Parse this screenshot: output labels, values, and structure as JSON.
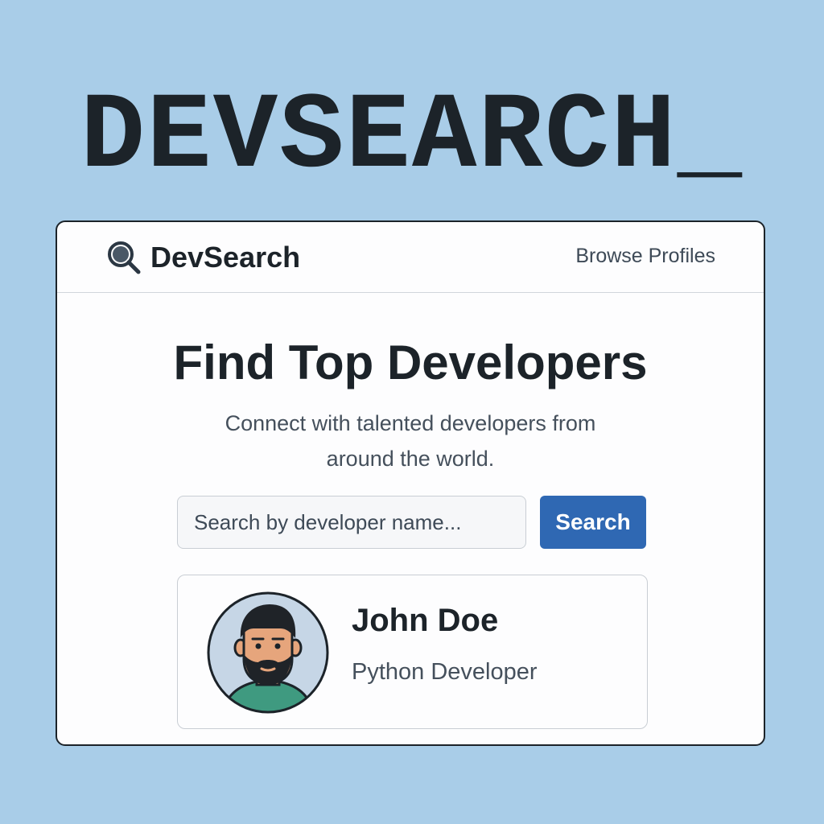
{
  "wordmark": "DEVSEARCH_",
  "navbar": {
    "brand_icon": "magnifier-icon",
    "brand_name": "DevSearch",
    "browse_link": "Browse Profiles"
  },
  "hero": {
    "title": "Find Top Developers",
    "subtitle": "Connect with talented developers from around the world."
  },
  "search": {
    "placeholder": "Search by developer name...",
    "value": "",
    "button_label": "Search"
  },
  "profile": {
    "avatar_icon": "developer-avatar",
    "name": "John Doe",
    "role": "Python Developer"
  },
  "colors": {
    "page_background": "#a9cde8",
    "accent": "#2f68b3",
    "text_dark": "#1c2329",
    "text_muted": "#45505c"
  }
}
